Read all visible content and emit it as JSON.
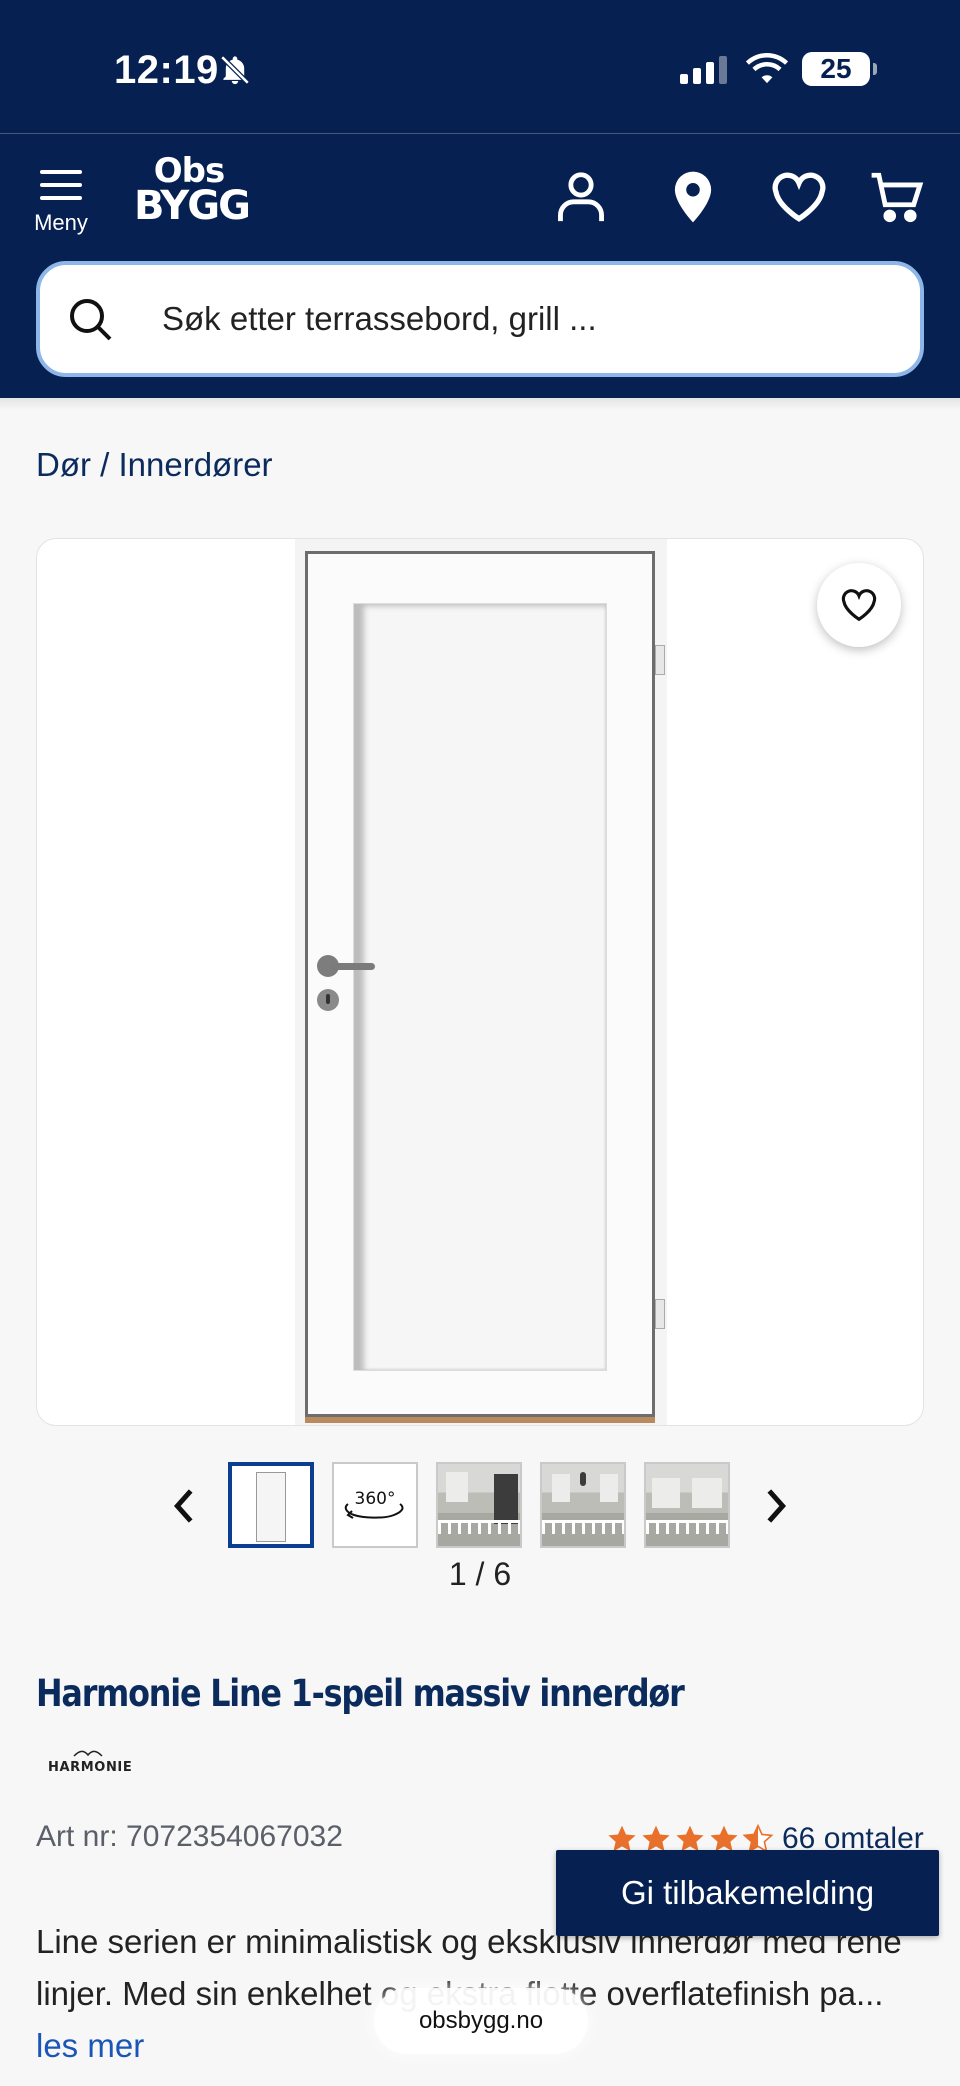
{
  "status_bar": {
    "time": "12:19",
    "battery": "25",
    "icons": [
      "bell-slash-icon",
      "signal-icon",
      "wifi-icon",
      "battery-icon"
    ]
  },
  "header": {
    "menu_label": "Meny",
    "logo_line1": "Obs",
    "logo_line2": "BYGG",
    "icons": [
      "user-icon",
      "location-pin-icon",
      "heart-icon",
      "cart-icon"
    ],
    "background": "#062151"
  },
  "search": {
    "placeholder": "Søk etter terrassebord, grill ...",
    "border_color": "#8cb7e8"
  },
  "breadcrumb": "Dør / Innerdører",
  "gallery": {
    "counter": "1 / 6",
    "thumbnail_360_label": "360°",
    "thumbnails": [
      "door-front",
      "360-view",
      "room-1",
      "room-2",
      "room-3"
    ]
  },
  "product": {
    "title": "Harmonie Line 1-speil massiv innerdør",
    "brand": "HARMONIE",
    "art_nr": "Art nr: 7072354067032",
    "rating": 4.5,
    "reviews": "66 omtaler",
    "star_color": "#e8702a",
    "description": "Line serien er minimalistisk og eksklusiv innerdør med rene linjer. Med sin enkelhet og ekstra flotte overflatefinish pa...",
    "read_more": "les mer"
  },
  "feedback_button": "Gi tilbakemelding",
  "url_pill": "obsbygg.no"
}
